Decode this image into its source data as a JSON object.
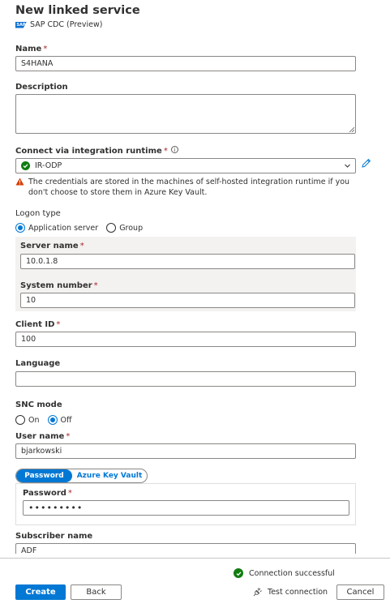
{
  "header": {
    "title": "New linked service",
    "subtitle": "SAP CDC (Preview)",
    "logo_text": "SAP"
  },
  "form": {
    "name": {
      "label": "Name",
      "required": "*",
      "value": "S4HANA"
    },
    "description": {
      "label": "Description",
      "value": ""
    },
    "runtime": {
      "label": "Connect via integration runtime",
      "required": "*",
      "info": "i",
      "value": "IR-ODP",
      "warning": "The credentials are stored in the machines of self-hosted integration runtime if you don't choose to store them in Azure Key Vault."
    },
    "logon_type": {
      "label": "Logon type",
      "options": [
        "Application server",
        "Group"
      ],
      "selected": "Application server"
    },
    "server_name": {
      "label": "Server name",
      "required": "*",
      "value": "10.0.1.8"
    },
    "system_number": {
      "label": "System number",
      "required": "*",
      "value": "10"
    },
    "client_id": {
      "label": "Client ID",
      "required": "*",
      "value": "100"
    },
    "language": {
      "label": "Language",
      "value": ""
    },
    "snc_mode": {
      "label": "SNC mode",
      "options": [
        "On",
        "Off"
      ],
      "selected": "Off"
    },
    "user_name": {
      "label": "User name",
      "required": "*",
      "value": "bjarkowski"
    },
    "auth_toggle": {
      "options": [
        "Password",
        "Azure Key Vault"
      ],
      "selected": "Password"
    },
    "password": {
      "label": "Password",
      "required": "*",
      "value": "•••••••••"
    },
    "subscriber_name": {
      "label": "Subscriber name",
      "value": "ADF"
    }
  },
  "footer": {
    "status": "Connection successful",
    "test_connection": "Test connection",
    "create": "Create",
    "back": "Back",
    "cancel": "Cancel"
  },
  "colors": {
    "accent": "#0078d4",
    "success": "#107c10",
    "warning": "#d83b01",
    "required": "#a4262c"
  }
}
